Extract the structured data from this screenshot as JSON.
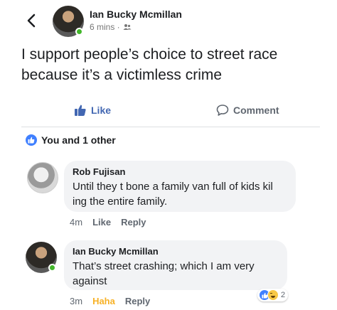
{
  "post": {
    "author": "Ian Bucky Mcmillan",
    "time": "6 mins ·",
    "audience_icon": "friends-icon",
    "text": "I support people’s choice to street race because it’s a victimless crime"
  },
  "actions": {
    "like_label": "Like",
    "comment_label": "Comment"
  },
  "reactions": {
    "summary": "You and 1 other"
  },
  "comments": [
    {
      "name": "Rob Fujisan",
      "text": "Until they t bone a family van full of kids kil ing the entire family.",
      "time": "4m",
      "like_label": "Like",
      "reply_label": "Reply"
    },
    {
      "name": "Ian Bucky Mcmillan",
      "text": "That’s street crashing; which I am very against",
      "time": "3m",
      "haha_label": "Haha",
      "reply_label": "Reply",
      "reaction_count": "2"
    }
  ],
  "colors": {
    "brand": "#4267b2",
    "like_badge": "#4080ff",
    "haha": "#f7b125",
    "online": "#42b72a",
    "bubble": "#f2f3f5"
  }
}
